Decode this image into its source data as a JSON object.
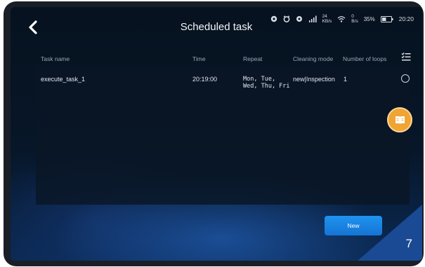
{
  "header": {
    "title": "Scheduled task",
    "back_icon": "chevron-left-icon"
  },
  "status_bar": {
    "icons": [
      "record-icon",
      "alarm-icon",
      "settings-icon",
      "signal-icon",
      "wifi-icon",
      "battery-icon"
    ],
    "network_speed": "24",
    "network_speed_unit": "KB/s",
    "wifi_speed": "0",
    "wifi_speed_unit": "B/s",
    "battery": "35%",
    "time": "20:20"
  },
  "table": {
    "columns": {
      "task_name": "Task name",
      "time": "Time",
      "repeat": "Repeat",
      "cleaning_mode": "Cleaning mode",
      "number_of_loops": "Number of loops"
    },
    "rows": [
      {
        "task_name": "execute_task_1",
        "time": "20:19:00",
        "repeat_line1": "Mon, Tue,",
        "repeat_line2": "Wed, Thu, Fri",
        "cleaning_mode": "new|Inspection",
        "number_of_loops": "1"
      }
    ]
  },
  "actions": {
    "new_label": "New",
    "manual_icon": "book-icon",
    "list_icon": "checklist-icon"
  },
  "page_number": "7",
  "colors": {
    "accent": "#1a82e6",
    "floating_button": "#f0a433",
    "corner": "#1a4a93"
  }
}
